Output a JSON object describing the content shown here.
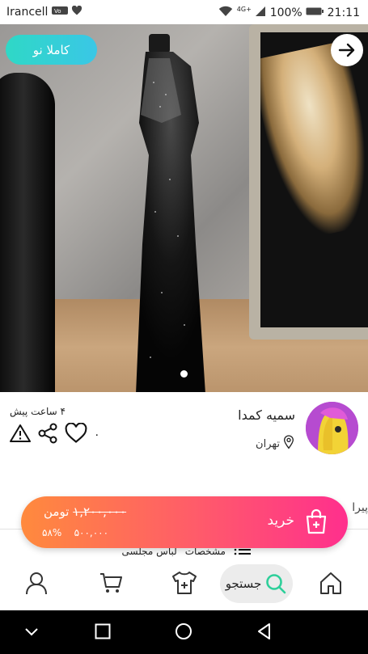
{
  "status_bar": {
    "carrier": "Irancell",
    "network": "4G+",
    "battery": "100%",
    "time": "21:11"
  },
  "product": {
    "condition_badge": "کاملا نو",
    "image_count": 1,
    "current_image": 1
  },
  "seller": {
    "name": "سمیه کمدا",
    "location": "تهران",
    "posted": "۴ ساعت پیش",
    "likes": "۰"
  },
  "buy_bar": {
    "buy_label": "خرید",
    "old_price": "۱,۲۰۰,۰۰۰",
    "currency": "تومن",
    "new_price": "۵۰۰,۰۰۰",
    "discount": "۵۸%"
  },
  "details": {
    "peek_text": "پیرا",
    "specs_label": "مشخصات",
    "category": "لباس مجلسی"
  },
  "bottom_nav": {
    "search_label": "جستجو"
  },
  "colors": {
    "accent_teal": "#2fd8c6",
    "buy_gradient_start": "#ff8a3d",
    "buy_gradient_end": "#ff2f8d",
    "search_icon": "#2ecf9a"
  }
}
